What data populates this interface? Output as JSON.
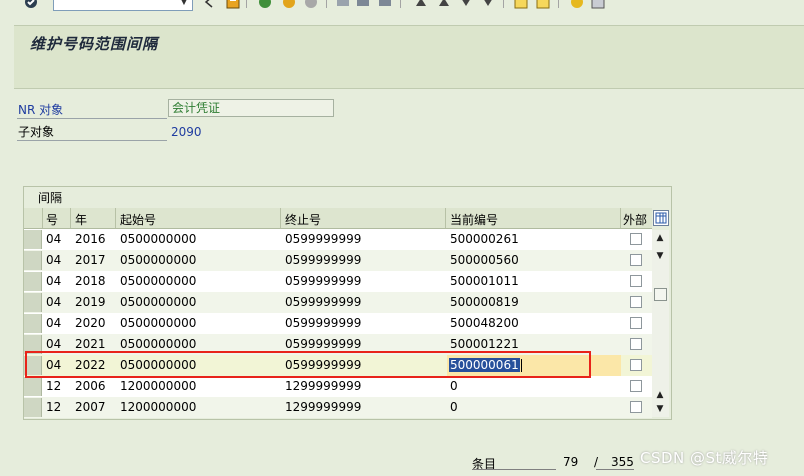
{
  "app": {
    "title": "维护号码范围间隔"
  },
  "form": {
    "nr_object_label": "NR 对象",
    "nr_object_value": "会计凭证",
    "subobject_label": "子对象",
    "subobject_value": "2090"
  },
  "table": {
    "title": "间隔",
    "headers": [
      "号",
      "年",
      "起始号",
      "终止号",
      "当前编号",
      "外部"
    ],
    "rows": [
      {
        "no": "04",
        "year": "2016",
        "from": "0500000000",
        "to": "0599999999",
        "current": "500000261",
        "ext": false
      },
      {
        "no": "04",
        "year": "2017",
        "from": "0500000000",
        "to": "0599999999",
        "current": "500000560",
        "ext": false
      },
      {
        "no": "04",
        "year": "2018",
        "from": "0500000000",
        "to": "0599999999",
        "current": "500001011",
        "ext": false
      },
      {
        "no": "04",
        "year": "2019",
        "from": "0500000000",
        "to": "0599999999",
        "current": "500000819",
        "ext": false
      },
      {
        "no": "04",
        "year": "2020",
        "from": "0500000000",
        "to": "0599999999",
        "current": "500048200",
        "ext": false
      },
      {
        "no": "04",
        "year": "2021",
        "from": "0500000000",
        "to": "0599999999",
        "current": "500001221",
        "ext": false
      },
      {
        "no": "04",
        "year": "2022",
        "from": "0500000000",
        "to": "0599999999",
        "current": "500000061",
        "ext": false
      },
      {
        "no": "12",
        "year": "2006",
        "from": "1200000000",
        "to": "1299999999",
        "current": "0",
        "ext": false
      },
      {
        "no": "12",
        "year": "2007",
        "from": "1200000000",
        "to": "1299999999",
        "current": "0",
        "ext": false
      }
    ],
    "selected_row": 6
  },
  "footer": {
    "entry_label": "条目",
    "entry_current": "79",
    "entry_slash": "/",
    "entry_total": "355"
  },
  "watermark": "CSDN @St威尔特",
  "colors": {
    "highlight": "#e8231a",
    "selection": "#27509b",
    "edit_bg": "#fbe7a8"
  }
}
